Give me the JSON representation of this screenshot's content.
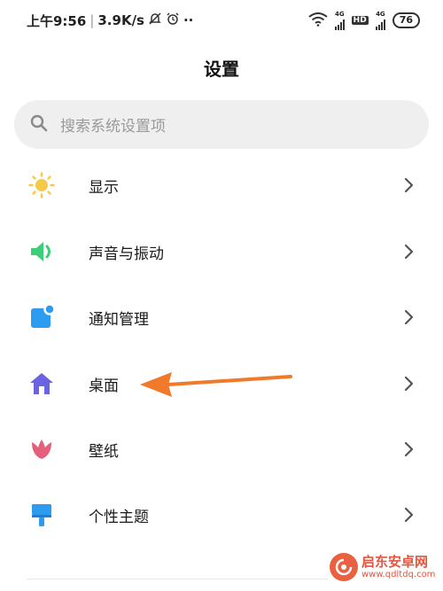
{
  "status_bar": {
    "time": "上午9:56",
    "speed": "3.9K/s",
    "sep": "|",
    "dots": "··",
    "net1": "4G",
    "hd": "HD",
    "net2": "4G",
    "battery": "76"
  },
  "page": {
    "title": "设置"
  },
  "search": {
    "placeholder": "搜索系统设置项"
  },
  "settings": [
    {
      "label": "显示",
      "icon": "sun-icon",
      "color": "#f7c948"
    },
    {
      "label": "声音与振动",
      "icon": "speaker-icon",
      "color": "#3ccf7a"
    },
    {
      "label": "通知管理",
      "icon": "notification-icon",
      "color": "#2d9bf0"
    },
    {
      "label": "桌面",
      "icon": "home-icon",
      "color": "#6c63e0"
    },
    {
      "label": "壁纸",
      "icon": "tulip-icon",
      "color": "#e4607a"
    },
    {
      "label": "个性主题",
      "icon": "paintbrush-icon",
      "color": "#2d9bf0"
    }
  ],
  "annotation": {
    "arrow_color": "#f07a2a"
  },
  "watermark": {
    "name": "启东安卓网",
    "url": "www.qdltdq.com"
  }
}
